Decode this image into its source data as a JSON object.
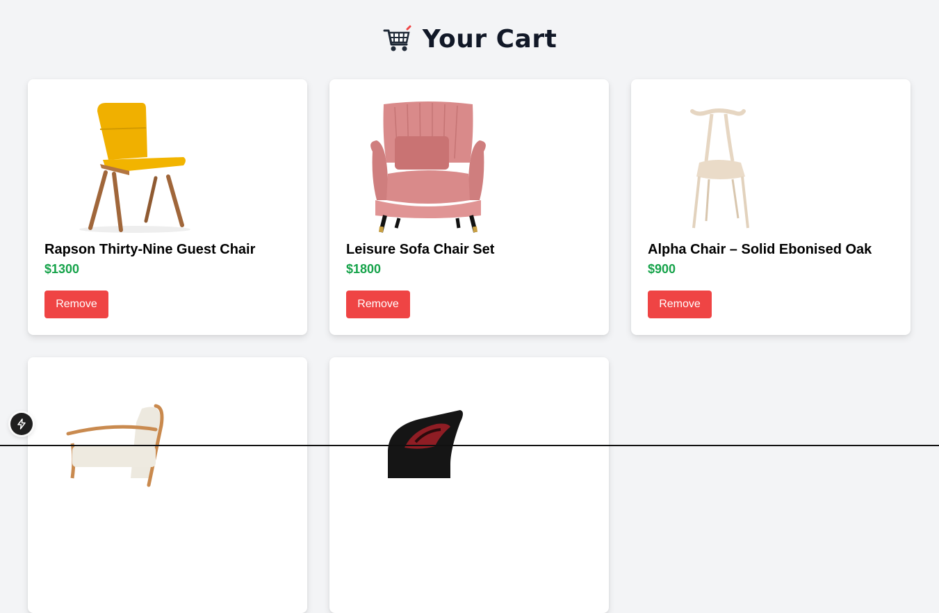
{
  "header": {
    "title": "Your Cart",
    "icon": "shopping-cart-icon"
  },
  "colors": {
    "price": "#16a34a",
    "remove": "#ef4444",
    "background": "#f3f4f6"
  },
  "products": [
    {
      "name": "Rapson Thirty-Nine Guest Chair",
      "price": "$1300",
      "remove_label": "Remove",
      "image": "yellow-lounge-chair"
    },
    {
      "name": "Leisure Sofa Chair Set",
      "price": "$1800",
      "remove_label": "Remove",
      "image": "pink-wingback-armchair"
    },
    {
      "name": "Alpha Chair – Solid Ebonised Oak",
      "price": "$900",
      "remove_label": "Remove",
      "image": "white-sculpted-chair"
    },
    {
      "image": "wooden-armchair"
    },
    {
      "image": "black-red-pod-chair"
    }
  ],
  "badge": {
    "icon": "lightning-bolt-icon"
  }
}
